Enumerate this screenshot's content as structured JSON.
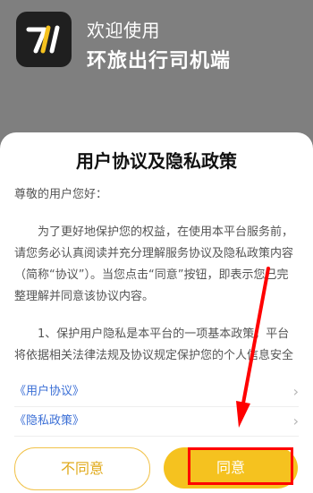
{
  "app": {
    "welcome_text": "欢迎使用",
    "name": "环旅出行司机端",
    "logo_icon": "app-logo-icon"
  },
  "dialog": {
    "title": "用户协议及隐私政策",
    "greeting": "尊敬的用户您好：",
    "paragraph1": "为了更好地保护您的权益，在使用本平台服务前，请您务必认真阅读并充分理解服务协议及隐私政策内容（简称“协议”）。当您点击“同意”按钮，即表示您已完整理解并同意该协议内容。",
    "paragraph2": "1、保护用户隐私是本平台的一项基本政策，平台将依据相关法律法规及协议规定保护您的个人信息安全",
    "links": [
      {
        "label": "《用户协议》",
        "icon": "chevron-right-icon"
      },
      {
        "label": "《隐私政策》",
        "icon": "chevron-right-icon"
      }
    ],
    "disagree_label": "不同意",
    "agree_label": "同意"
  },
  "colors": {
    "overlay": "#7f7f7f",
    "accent": "#f5c21f",
    "link": "#3b6fd6",
    "annotation": "#ff0000"
  }
}
